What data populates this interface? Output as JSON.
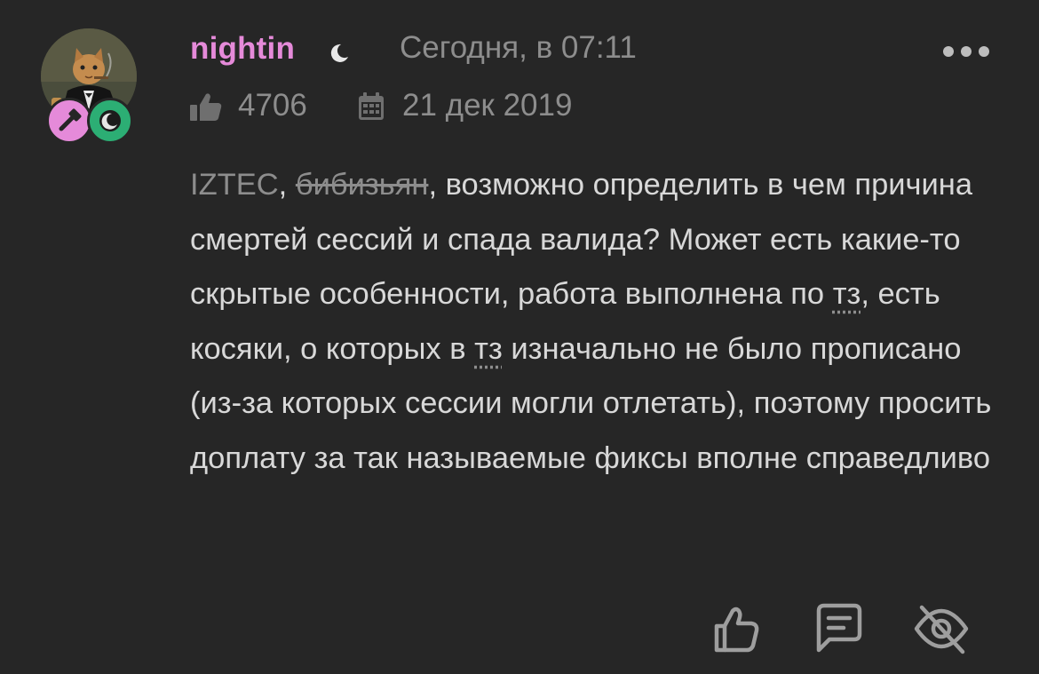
{
  "post": {
    "author": {
      "username": "nightin",
      "avatar_icon": "cat-in-suit-avatar",
      "badges": [
        "role-badge-icon",
        "moon-badge-icon"
      ],
      "status_icon": "moon-icon"
    },
    "timestamp": "Сегодня, в 07:11",
    "likes_count": "4706",
    "registration_date": "21 дек 2019",
    "text": {
      "mention": "IZTEC",
      "sep1": ", ",
      "strikethrough": "бибизьян",
      "part1": ", возможно определить в чем причина смертей сессий и спада валида? Может есть какие-то скрытые особенности, работа выполнена по ",
      "abbr1": "тз",
      "part2": ", есть косяки, о которых в ",
      "abbr2": "тз",
      "part3": " изначально не было прописано (из-за которых сессии могли отлетать), поэтому просить доплату за так называемые фиксы вполне справедливо"
    },
    "actions": [
      "like-icon",
      "reply-icon",
      "hide-icon"
    ]
  },
  "colors": {
    "background": "#262626",
    "username": "#e58ad9",
    "muted": "#8d8d8d",
    "text": "#d8d8d8",
    "badge_green": "#2cae74"
  }
}
